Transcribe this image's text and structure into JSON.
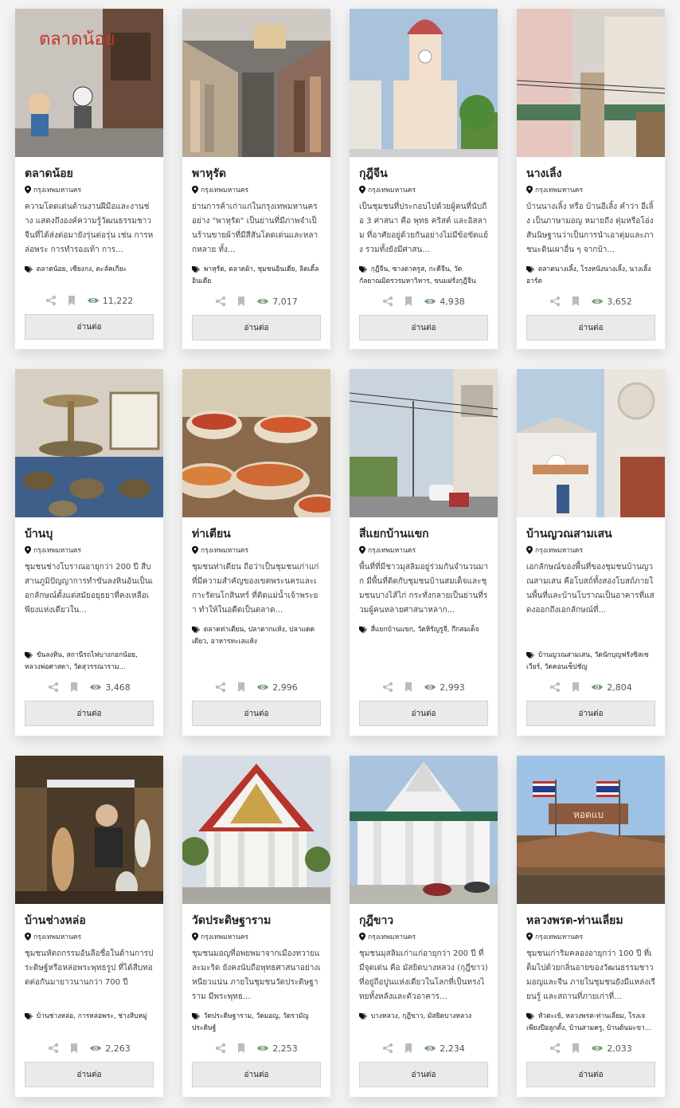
{
  "read_more_label": "อ่านต่อ",
  "accent_color": "#7a9b7a",
  "cards": [
    {
      "title": "ตลาดน้อย",
      "location": "กรุงเทพมหานคร",
      "desc": "ความโดดเด่นด้านงานฝีมือและงานช่าง แสดงถึงองค์ความรู้วัฒนธรรมชาวจีนที่ได้ส่งต่อมายังรุ่นต่อรุ่น เช่น การหล่อพระ การทำรองเท้า การ...",
      "tags": "ตลาดน้อย, เซียงกง, ตะลัคเกียะ",
      "views": "11,222"
    },
    {
      "title": "พาหุรัด",
      "location": "กรุงเทพมหานคร",
      "desc": "ย่านการค้าเก่าแก่ในกรุงเทพมหานคร อย่าง \"พาหุรัด\" เป็นย่านที่มีภาพจำเป็นร้านขายผ้าที่มีสีสันโดดเด่นและหลากหลาย ทั้ง...",
      "tags": "พาหุรัด, ตลาดผ้า, ชุมชนอินเดีย, ลิตเติ้ลอินเดีย",
      "views": "7,017"
    },
    {
      "title": "กุฎีจีน",
      "location": "กรุงเทพมหานคร",
      "desc": "เป็นชุมชนที่ประกอบไปด้วยผู้คนที่นับถือ 3 ศาสนา คือ พุทธ คริสต์ และอิสลาม ที่อาศัยอยู่ด้วยกันอย่างไม่มีข้อขัดแย้ง รวมทั้งยังมีศาสน...",
      "tags": "กุฎีจีน, ซางตาครูส, กะดีจีน, วัดกัลยาณมิตรวรมหาวิหาร, ขนมฝรั่งกุฎีจีน",
      "views": "4,938"
    },
    {
      "title": "นางเลิ้ง",
      "location": "กรุงเทพมหานคร",
      "desc": "บ้านนางเลิ้ง หรือ บ้านอีเลิ้ง คำว่า อีเลิ้ง เป็นภาษามอญ หมายถึง ตุ่มหรือโอ่ง สันนิษฐานว่าเป็นการนำเอาตุ่มและภาชนะดินเผาอื่น ๆ จากบ้า...",
      "tags": "ตลาดนางเลิ้ง, โรงหนังนางเลิ้ง, นางเลิ้งอาร์ต",
      "views": "3,652"
    },
    {
      "title": "บ้านบุ",
      "location": "กรุงเทพมหานคร",
      "desc": "ชุมชนช่างโบราณอายุกว่า 200 ปี สืบสานภูมิปัญญาการทำขันลงหินอันเป็นเอกลักษณ์ตั้งแต่สมัยอยุธยาที่คงเหลือเพียงแห่งเดียวใน...",
      "tags": "ขันลงหิน, สถานีรถไฟบางกอกน้อย, หลวงพ่อศาสดา, วัดสุวรรณาราม...",
      "views": "3,468"
    },
    {
      "title": "ท่าเตียน",
      "location": "กรุงเทพมหานคร",
      "desc": "ชุมชนท่าเตียน ถือว่าเป็นชุมชนเก่าแก่ที่มีความสำคัญของเขตพระนครและเกาะรัตนโกสินทร์ ที่ติดแม่น้ำเจ้าพระยา ทำให้ในอดีตเป็นตลาด...",
      "tags": "ตลาดท่าเตียน, ปลาตากแห้ง, ปลาแดดเดียว, อาหารทะเลแห้ง",
      "views": "2,996"
    },
    {
      "title": "สี่แยกบ้านแขก",
      "location": "กรุงเทพมหานคร",
      "desc": "พื้นที่ที่มีชาวมุสลิมอยู่ร่วมกันจำนวนมาก มีพื้นที่ติดกับชุมชนบ้านสมเด็จและชุมชนบางไส้ไก่ กระทั่งกลายเป็นย่านที่รวมผู้คนหลายศาสนาหลาก...",
      "tags": "สี่แยกบ้านแขก, วัดหิรัญรูจี, กึกสมเด็จ",
      "views": "2,993"
    },
    {
      "title": "บ้านญวณสามเสน",
      "location": "กรุงเทพมหานคร",
      "desc": "เอกลักษณ์ของพื้นที่ของชุมชนบ้านญวณสามเสน คือโบสถ์ทั้งสองโบสถ์ภายในพื้นที่และบ้านโบราณเป็นอาคารที่แสดงออกถึงเอกลักษณ์ที่...",
      "tags": "บ้านญวณสามเสน, วัดนักบุญฟรังซิสเซเวียร์, วัดคอนเซ็ปชัญ",
      "views": "2,804"
    },
    {
      "title": "บ้านช่างหล่อ",
      "location": "กรุงเทพมหานคร",
      "desc": "ชุมชนหัตถกรรมอันลือชื่อในด้านการประดิษฐ์หรือหล่อพระพุทธรูป ที่ได้สืบทอดต่อกันมายาวนานกว่า 700 ปี",
      "tags": "บ้านช่างหล่อ, การหล่อพระ, ช่างสิบหมู่",
      "views": "2,263"
    },
    {
      "title": "วัดประดิษฐาราม",
      "location": "กรุงเทพมหานคร",
      "desc": "ชุมชนมอญที่อพยพมาจากเมืองทวายและมะริด ยังคงนับถือพุทธศาสนาอย่างเหนียวแน่น ภายในชุมชนวัดประดิษฐาราม มีพระพุทธ...",
      "tags": "วัดประดิษฐาราม, วัดมอญ, วัดรามัญประดิษฐ์",
      "views": "2,253"
    },
    {
      "title": "กุฎีขาว",
      "location": "กรุงเทพมหานคร",
      "desc": "ชุมชนมุสลิมเก่าแก่อายุกว่า 200 ปี ที่มีจุดเด่น คือ มัสยิดบางหลวง (กุฎีขาว) ที่อยู่ถือปูนแห่งเดียวในโลกที่เป็นทรงไทยทั้งหลังและตัวอาคาร...",
      "tags": "บางหลวง, กุฎีขาว, มัสยิดบางหลวง",
      "views": "2,234"
    },
    {
      "title": "หลวงพรต-ท่านเลี่ยม",
      "location": "กรุงเทพมหานคร",
      "desc": "ชุมชนเก่าริมคลองอายุกว่า 100 ปี ที่เต็มไปด้วยกลิ่นอายของวัฒนธรรมชาวมอญและจีน ภายในชุมชนยังมีแหล่งเรียนรู้ และสถานที่ภายเก่าที่...",
      "tags": "หัวตะเข้, หลวงพรต-ท่านเลี่ยม, โรงเจเพียงปีอลูกตั้ง, บ้านสามครู, บ้านต้นมะขา...",
      "views": "2,033"
    }
  ]
}
